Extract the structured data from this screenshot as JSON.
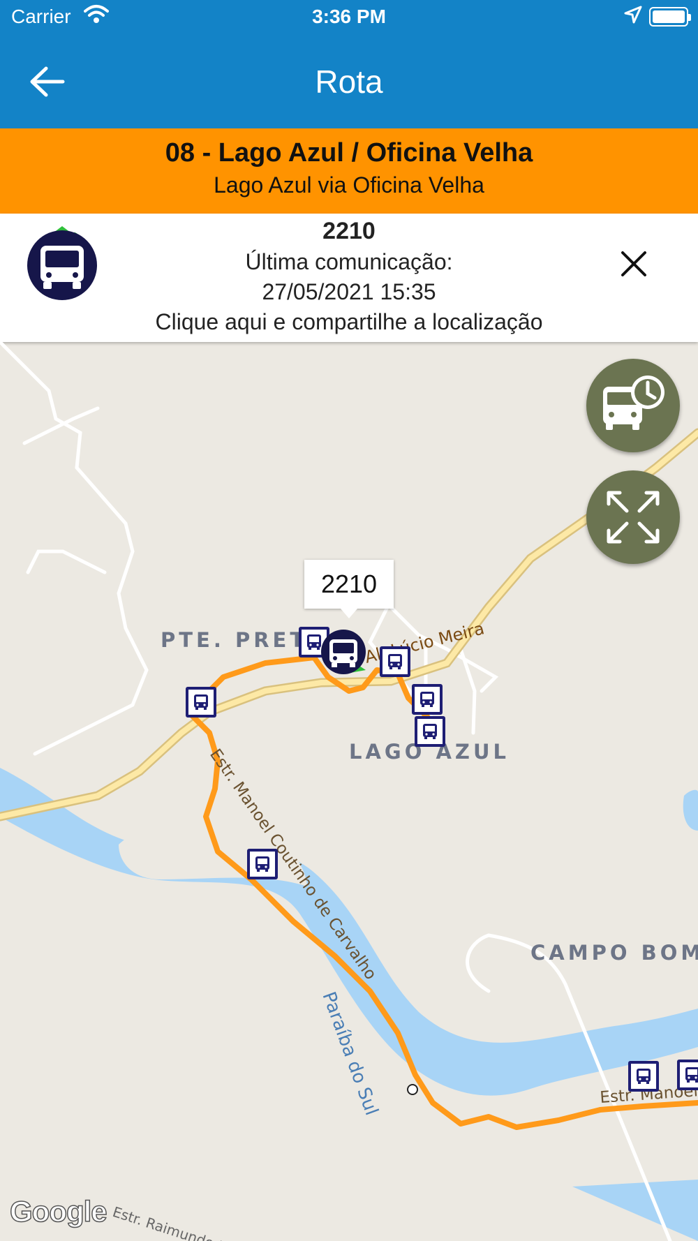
{
  "status_bar": {
    "carrier": "Carrier",
    "time": "3:36 PM"
  },
  "nav": {
    "title": "Rota"
  },
  "route": {
    "name": "08 - Lago Azul / Oficina Velha",
    "subtitle": "Lago Azul via Oficina Velha"
  },
  "vehicle": {
    "id": "2210",
    "last_comm_label": "Última comunicação:",
    "last_comm_time": "27/05/2021 15:35",
    "share_text": "Clique aqui e compartilhe a localização"
  },
  "map": {
    "callout": "2210",
    "labels": {
      "pte_preta": "PTE. PRETA",
      "lago_azul": "LAGO AZUL",
      "campo_bom": "CAMPO BOM",
      "road_lucio": "Al. Lúcio Meira",
      "road_manoel": "Estr. Manoel Coutinho de Carvalho",
      "road_manoel2": "Estr. Manoel",
      "river": "Paraíba do Sul",
      "road_raimundo": "Estr. Raimundo Padilha"
    },
    "attribution": "Google"
  },
  "colors": {
    "header": "#1383c7",
    "route_bar": "#ff9300",
    "route_line": "#ff9a1a",
    "fab": "#6b7451",
    "stop_border": "#1e1e74"
  }
}
